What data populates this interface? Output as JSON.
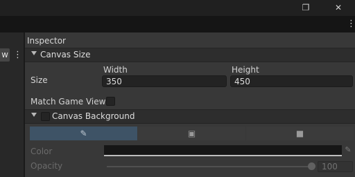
{
  "window": {
    "controls": [
      "restore-icon",
      "close-icon"
    ],
    "restore_glyph": "❐",
    "close_glyph": "✕"
  },
  "toolbar": {
    "menu_glyph": "⋮"
  },
  "left_pane": {
    "tab_letter": "w",
    "menu_glyph": "⋮"
  },
  "inspector": {
    "title": "Inspector",
    "canvas_size": {
      "header": "Canvas Size",
      "size_label": "Size",
      "width_label": "Width",
      "width_value": "350",
      "height_label": "Height",
      "height_value": "450",
      "match_game_view_label": "Match Game View",
      "match_game_view_checked": false
    },
    "canvas_background": {
      "header": "Canvas Background",
      "enabled": false,
      "modes": [
        {
          "icon": "eyedropper-icon",
          "glyph": "✎",
          "selected": true
        },
        {
          "icon": "image-icon",
          "glyph": "▣",
          "selected": false
        },
        {
          "icon": "video-camera-icon",
          "glyph": "■",
          "selected": false
        }
      ],
      "color_label": "Color",
      "color_value": "#161616",
      "opacity_label": "Opacity",
      "opacity_value": "100"
    }
  },
  "colors": {
    "selected_segment": "#3e5366",
    "panel_bg": "#383838",
    "header_bg": "#2d2d2d"
  }
}
